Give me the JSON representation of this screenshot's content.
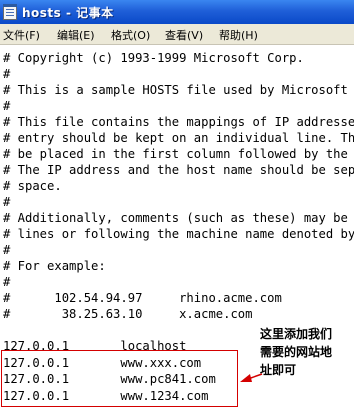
{
  "window": {
    "title": "hosts - 记事本"
  },
  "menu": [
    "文件(F)",
    "编辑(E)",
    "格式(O)",
    "查看(V)",
    "帮助(H)"
  ],
  "editor": {
    "lines": [
      "# Copyright (c) 1993-1999 Microsoft Corp.",
      "#",
      "# This is a sample HOSTS file used by Microsoft",
      "#",
      "# This file contains the mappings of IP addresses",
      "# entry should be kept on an individual line. The",
      "# be placed in the first column followed by the",
      "# The IP address and the host name should be sep",
      "# space.",
      "#",
      "# Additionally, comments (such as these) may be",
      "# lines or following the machine name denoted by",
      "#",
      "# For example:",
      "#",
      "#      102.54.94.97     rhino.acme.com",
      "#       38.25.63.10     x.acme.com",
      "",
      "127.0.0.1       localhost",
      "127.0.0.1       www.xxx.com",
      "127.0.0.1       www.pc841.com",
      "127.0.0.1       www.1234.com"
    ]
  },
  "annotation": {
    "text": "这里添加我们\n需要的网站地\n址即可",
    "color": "#d40000"
  },
  "colors": {
    "titlebar": "#0a49c8",
    "menubar": "#ece9d8",
    "highlight": "#d40000"
  }
}
